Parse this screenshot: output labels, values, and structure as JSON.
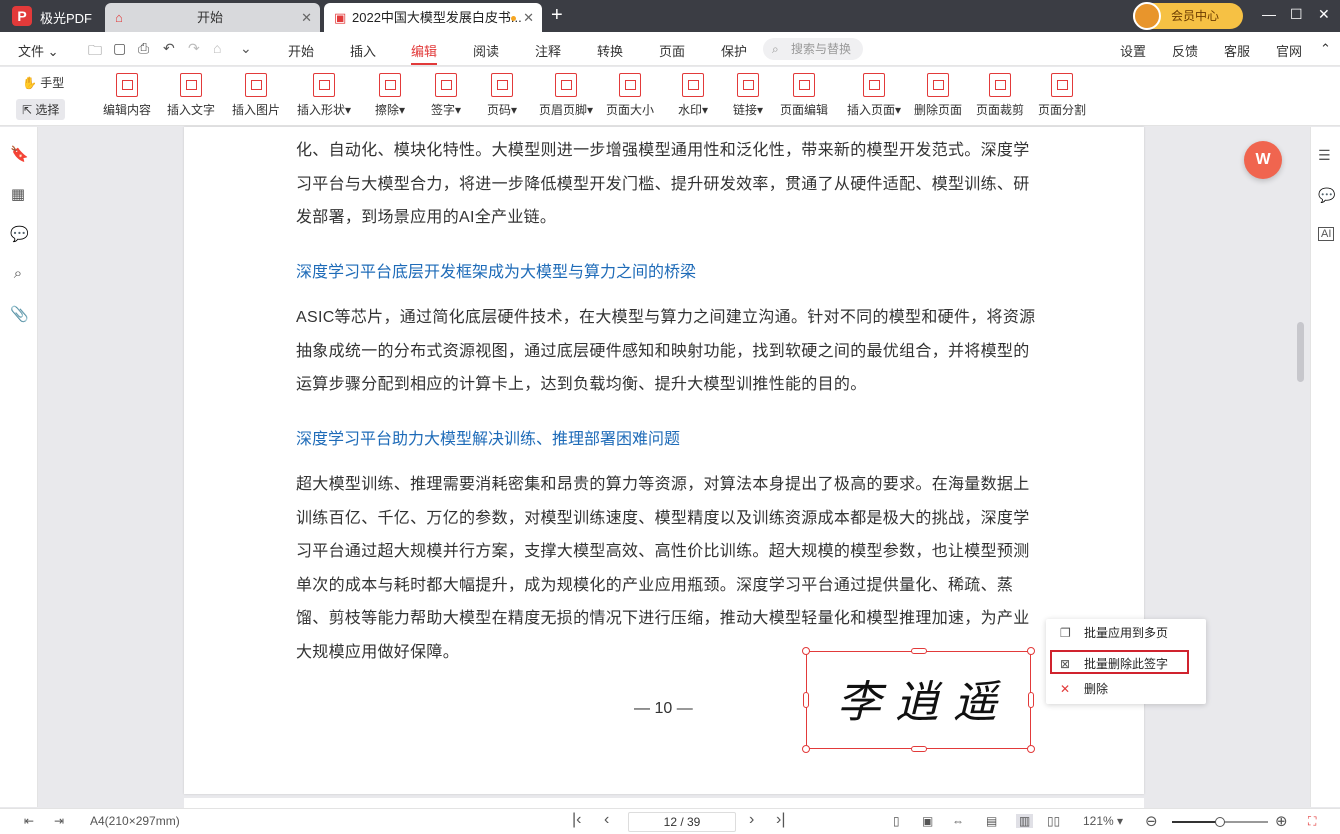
{
  "app": {
    "logo": "P",
    "name": "极光PDF"
  },
  "tabs": [
    {
      "label": "开始",
      "icon": "home-icon"
    },
    {
      "label": "2022中国大模型发展白皮书...",
      "icon": "pdf-file-icon"
    }
  ],
  "vip": {
    "label": "会员中心"
  },
  "menu": {
    "file": "文件",
    "items": [
      "开始",
      "插入",
      "编辑",
      "阅读",
      "注释",
      "转换",
      "页面",
      "保护"
    ],
    "active": "编辑",
    "search_placeholder": "搜索与替换",
    "right": [
      "设置",
      "反馈",
      "客服",
      "官网"
    ]
  },
  "modes": {
    "hand": "手型",
    "select": "选择"
  },
  "tools": [
    "编辑内容",
    "插入文字",
    "插入图片",
    "插入形状",
    "擦除",
    "签字",
    "页码",
    "页眉页脚",
    "页面大小",
    "水印",
    "链接",
    "页面编辑",
    "插入页面",
    "删除页面",
    "页面裁剪",
    "页面分割"
  ],
  "document": {
    "para1": "化、自动化、模块化特性。大模型则进一步增强模型通用性和泛化性，带来新的模型开发范式。深度学习平台与大模型合力，将进一步降低模型开发门槛、提升研发效率，贯通了从硬件适配、模型训练、研发部署，到场景应用的AI全产业链。",
    "heading1": "深度学习平台底层开发框架成为大模型与算力之间的桥梁",
    "para2": "ASIC等芯片，通过简化底层硬件技术，在大模型与算力之间建立沟通。针对不同的模型和硬件，将资源抽象成统一的分布式资源视图，通过底层硬件感知和映射功能，找到软硬之间的最优组合，并将模型的运算步骤分配到相应的计算卡上，达到负载均衡、提升大模型训推性能的目的。",
    "heading2": "深度学习平台助力大模型解决训练、推理部署困难问题",
    "para3": "超大模型训练、推理需要消耗密集和昂贵的算力等资源，对算法本身提出了极高的要求。在海量数据上训练百亿、千亿、万亿的参数，对模型训练速度、模型精度以及训练资源成本都是极大的挑战，深度学习平台通过超大规模并行方案，支撑大模型高效、高性价比训练。超大规模的模型参数，也让模型预测单次的成本与耗时都大幅提升，成为规模化的产业应用瓶颈。深度学习平台通过提供量化、稀疏、蒸馏、剪枝等能力帮助大模型在精度无损的情况下进行压缩，推动大模型轻量化和模型推理加速，为产业大规模应用做好保障。",
    "page_number": "— 10 —",
    "signature": "李逍遥"
  },
  "context_menu": [
    {
      "label": "批量应用到多页",
      "icon": "copy-pages-icon"
    },
    {
      "label": "批量删除此签字",
      "icon": "batch-delete-icon",
      "highlighted": true
    },
    {
      "label": "删除",
      "icon": "close-x-icon"
    }
  ],
  "status": {
    "page_size": "A4(210×297mm)",
    "page_indicator": "12 / 39",
    "zoom": "121%",
    "zoom_fraction": 0.5
  },
  "colors": {
    "accent": "#e23a3a",
    "heading": "#1e6bb8",
    "highlight_border": "#d0232e"
  }
}
